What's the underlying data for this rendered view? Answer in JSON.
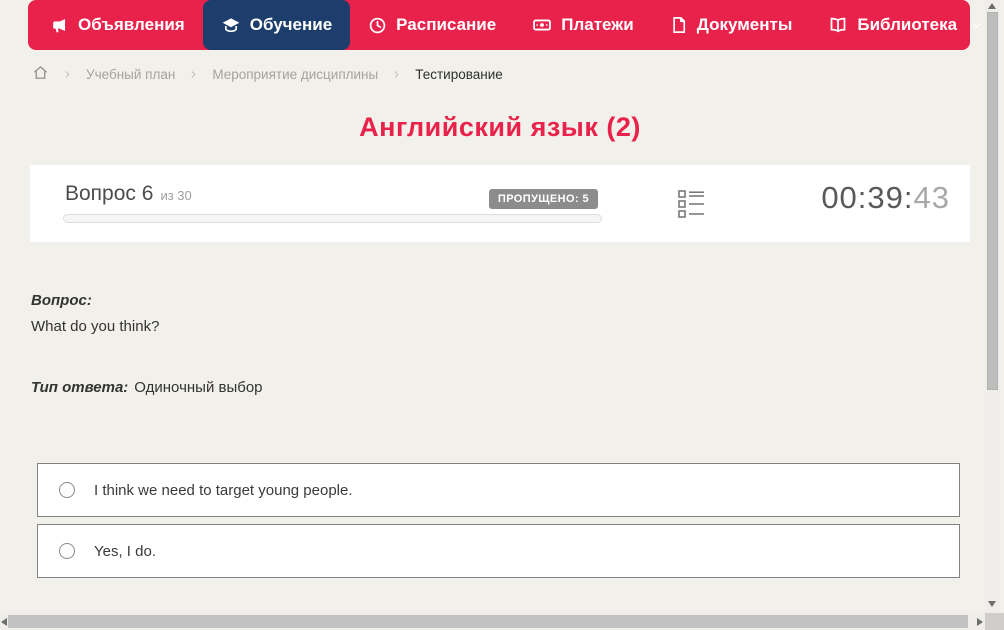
{
  "colors": {
    "accent_red": "#e8224a",
    "active_navy": "#1d3e6d",
    "badge_gray": "#8c8c8c",
    "page_background": "#f2f0eb"
  },
  "navbar": {
    "items": [
      {
        "label": "Объявления",
        "icon": "megaphone-icon",
        "active": false
      },
      {
        "label": "Обучение",
        "icon": "graduation-cap-icon",
        "active": true
      },
      {
        "label": "Расписание",
        "icon": "clock-icon",
        "active": false
      },
      {
        "label": "Платежи",
        "icon": "cash-icon",
        "active": false
      },
      {
        "label": "Документы",
        "icon": "document-icon",
        "active": false
      },
      {
        "label": "Библиотека",
        "icon": "book-icon",
        "active": false,
        "has_dropdown": true
      }
    ]
  },
  "breadcrumb": {
    "items": [
      "Учебный план",
      "Мероприятие дисциплины",
      "Тестирование"
    ]
  },
  "page_title": "Английский язык (2)",
  "quiz_panel": {
    "question_number_label": "Вопрос 6",
    "question_total_label": "из 30",
    "skipped_badge": "ПРОПУЩЕНО: 5",
    "progress_percent": 0,
    "timer_hhmm": "00:39:",
    "timer_seconds": "43"
  },
  "question": {
    "heading": "Вопрос:",
    "text": "What do you think?",
    "type_label": "Тип ответа:",
    "type_value": "Одиночный выбор",
    "options": [
      "I think we need to target young people.",
      "Yes, I do."
    ]
  }
}
